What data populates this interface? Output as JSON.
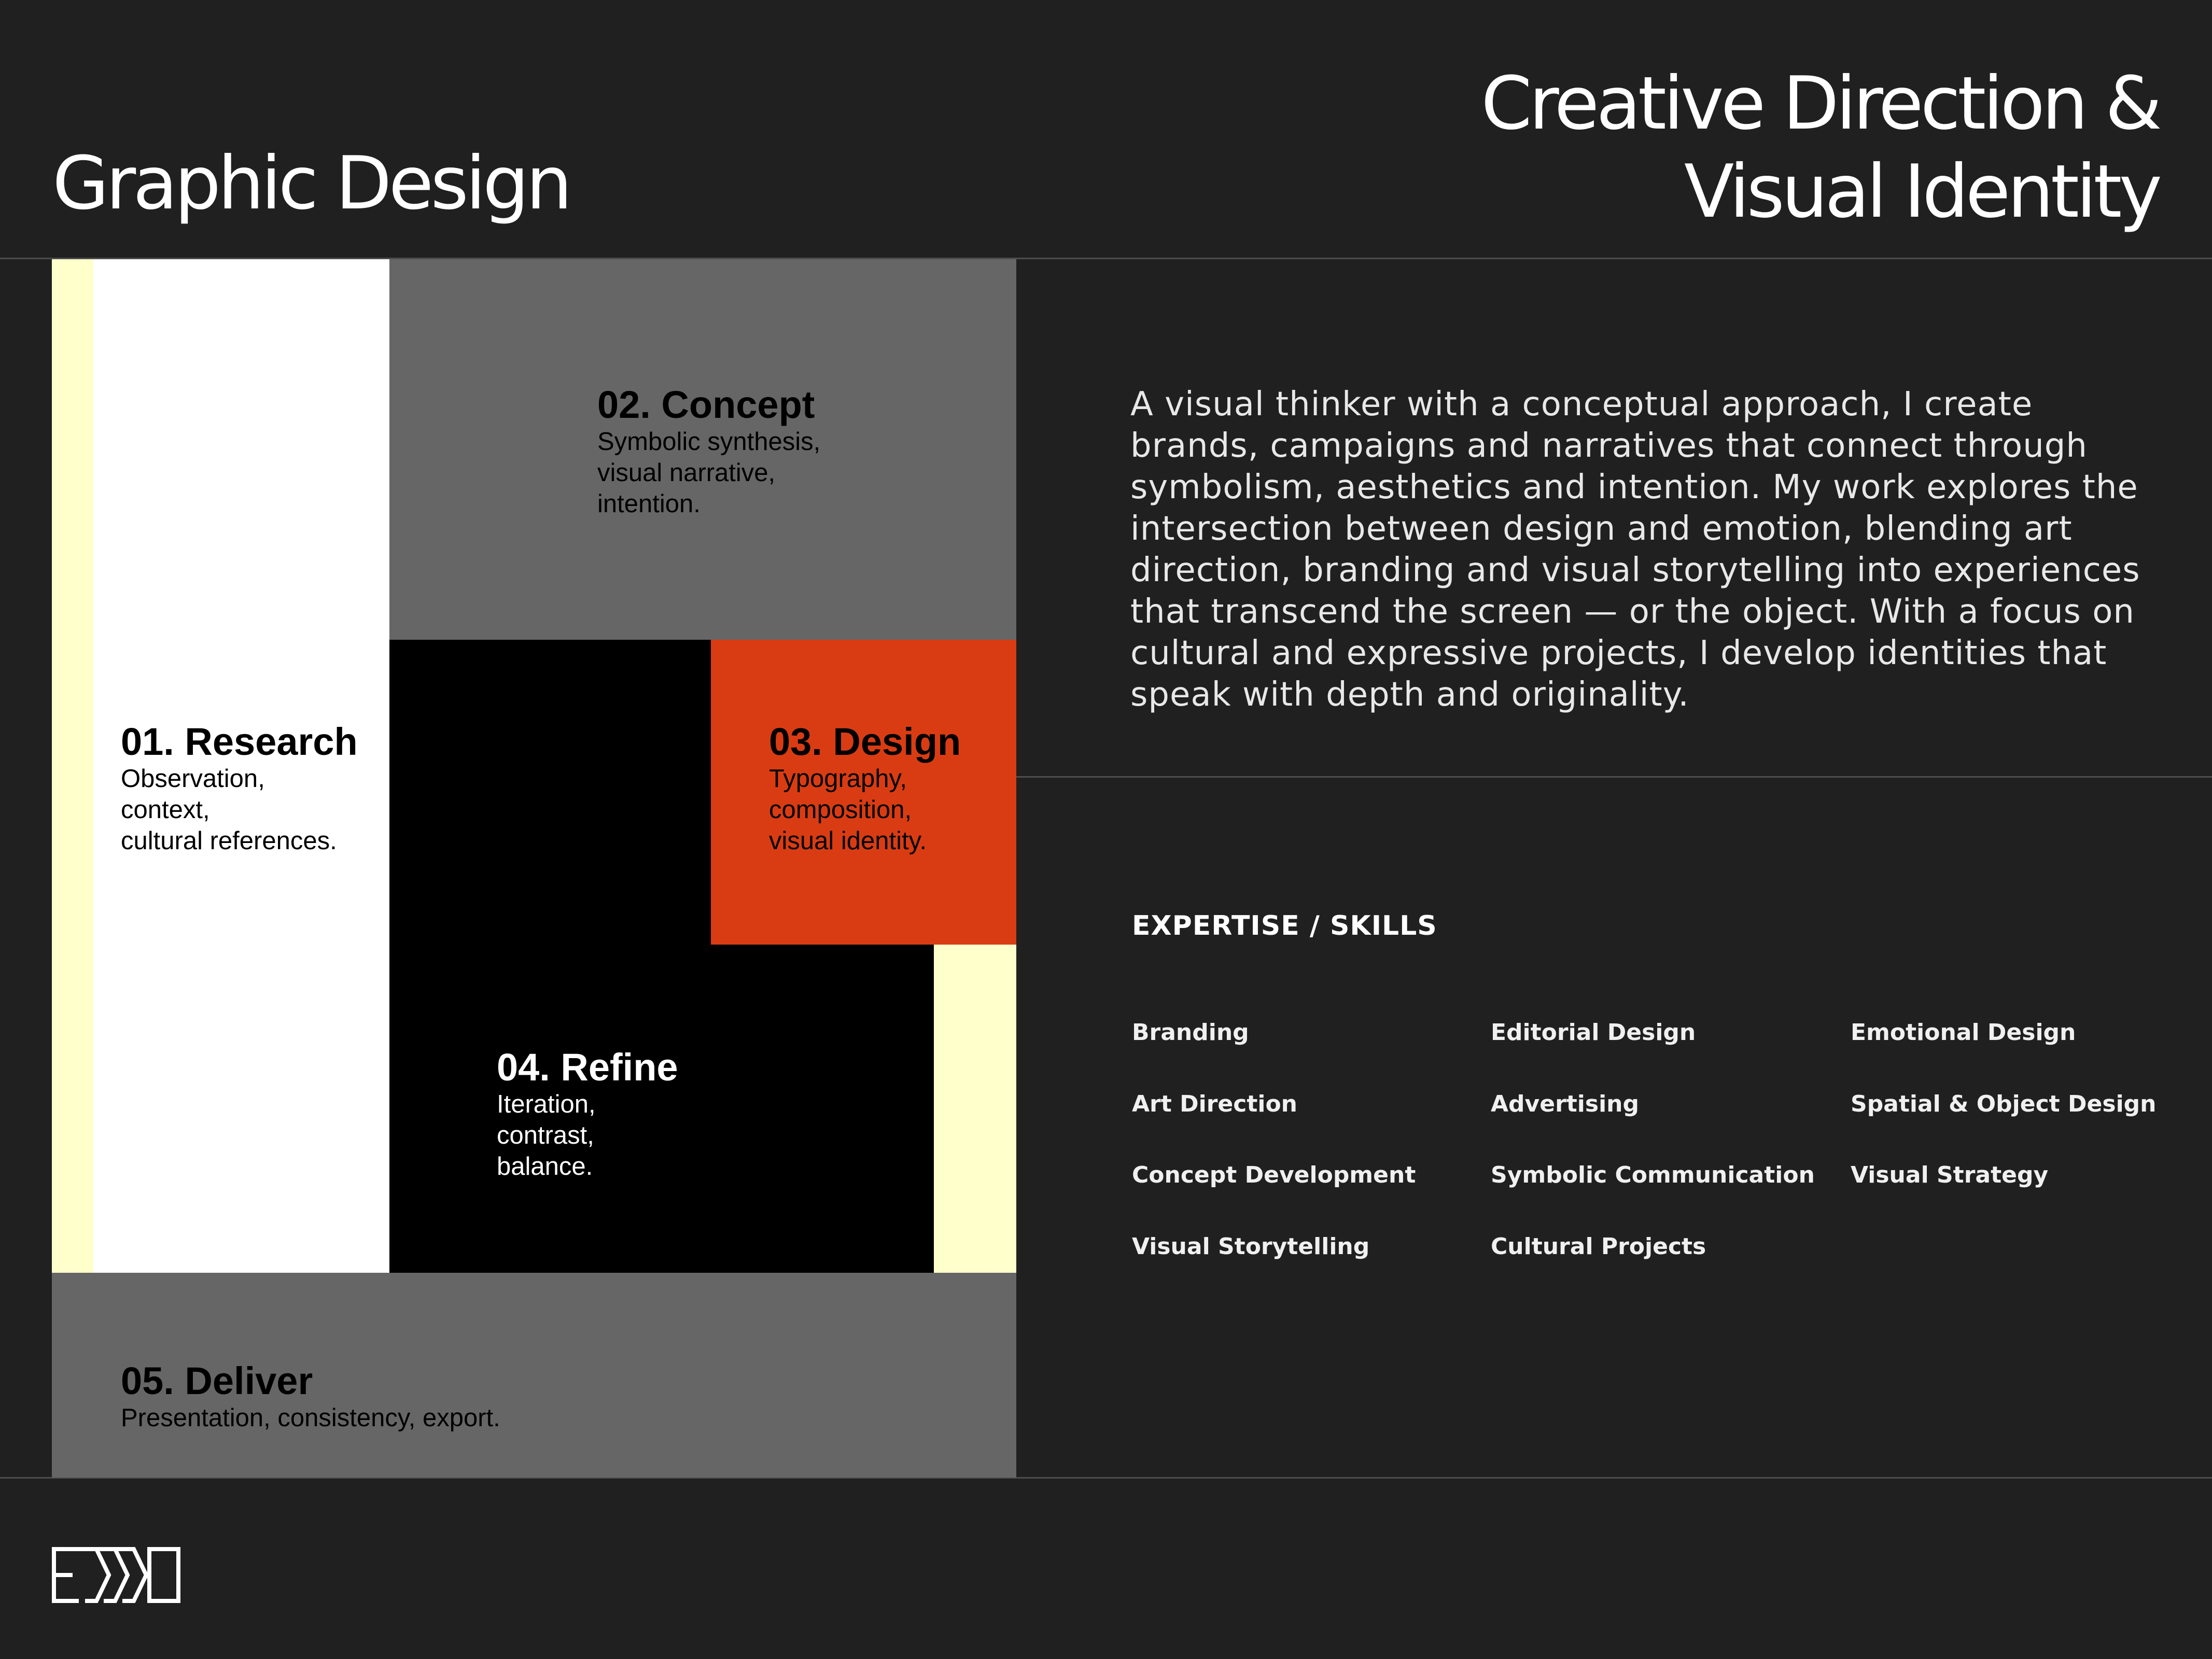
{
  "header": {
    "title_left": "Graphic Design",
    "title_right_line1": "Creative Direction &",
    "title_right_line2": "Visual Identity"
  },
  "colors": {
    "background": "#202020",
    "white_block": "#ffffff",
    "cream_accent": "#ffffcc",
    "gray_block": "#666666",
    "black_block": "#000000",
    "orange_block": "#d93c13",
    "divider": "#4d4d4d"
  },
  "process": {
    "steps": [
      {
        "title": "01. Research",
        "desc": "Observation,\ncontext,\ncultural references."
      },
      {
        "title": "02. Concept",
        "desc": "Symbolic synthesis,\nvisual narrative,\nintention."
      },
      {
        "title": "03. Design",
        "desc": "Typography,\ncomposition,\nvisual identity."
      },
      {
        "title": "04. Refine",
        "desc": "Iteration,\ncontrast,\nbalance."
      },
      {
        "title": "05. Deliver",
        "desc": "Presentation, consistency, export."
      }
    ]
  },
  "bio": "A visual thinker with a conceptual approach, I create brands, campaigns and narratives that connect through symbolism, aesthetics and intention. My work explores the intersection between design and emotion, blending art direction, branding and visual storytelling into experiences that transcend the screen — or the object. With a focus on cultural and expressive projects, I develop identities that speak with depth and originality.",
  "skills": {
    "heading": "EXPERTISE / SKILLS",
    "items": [
      "Branding",
      "Editorial Design",
      "Emotional Design",
      "Art Direction",
      "Advertising",
      "Spatial & Object Design",
      "Concept Development",
      "Symbolic Communication",
      "Visual Strategy",
      "Visual Storytelling",
      "Cultural Projects"
    ]
  },
  "footer": {
    "logo_icon": "brand-monogram-icon"
  }
}
